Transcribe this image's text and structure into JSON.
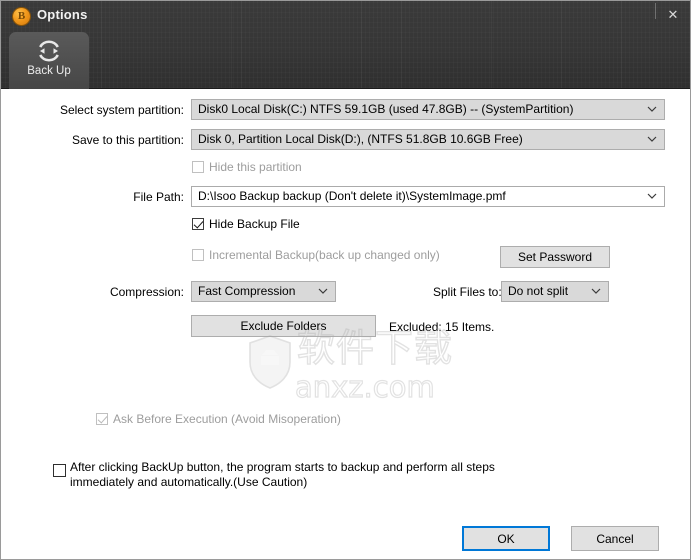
{
  "window": {
    "title": "Options",
    "logo_glyph": "B",
    "close_label": "✕"
  },
  "tabs": [
    {
      "label": "Back Up",
      "icon": "sync-circle-icon",
      "active": true
    }
  ],
  "form": {
    "select_system_partition": {
      "label": "Select system partition:",
      "value": "Disk0  Local Disk(C:) NTFS 59.1GB (used 47.8GB) -- (SystemPartition)"
    },
    "save_to_partition": {
      "label": "Save to this partition:",
      "value": "Disk 0, Partition Local Disk(D:), (NTFS 51.8GB 10.6GB Free)"
    },
    "hide_this_partition": {
      "label": "Hide this partition",
      "checked": false,
      "enabled": false
    },
    "file_path": {
      "label": "File Path:",
      "value": "D:\\Isoo Backup backup (Don't delete it)\\SystemImage.pmf"
    },
    "hide_backup_file": {
      "label": "Hide Backup File",
      "checked": true,
      "enabled": true
    },
    "incremental_backup": {
      "label": "Incremental Backup(back up changed only)",
      "checked": false,
      "enabled": false
    },
    "set_password_button": "Set Password",
    "compression": {
      "label": "Compression:",
      "value": "Fast Compression"
    },
    "split_files": {
      "label": "Split Files to:",
      "value": "Do not split"
    },
    "exclude_folders_button": "Exclude Folders",
    "excluded_status": "Excluded: 15 Items.",
    "auto_backup": {
      "label": "After clicking BackUp button, the program starts to backup and perform all steps immediately and automatically.(Use Caution)",
      "checked": false,
      "enabled": true
    },
    "ask_before_execution": {
      "label": "Ask Before Execution (Avoid Misoperation)",
      "checked": true,
      "enabled": false
    }
  },
  "footer": {
    "ok_label": "OK",
    "cancel_label": "Cancel"
  },
  "watermark": {
    "text": "软件下载",
    "site": "anxz.com"
  },
  "colors": {
    "accent": "#0078d7",
    "header_dark": "#363636",
    "logo_orange": "#f2991c",
    "disabled_text": "#9a9a9a"
  }
}
